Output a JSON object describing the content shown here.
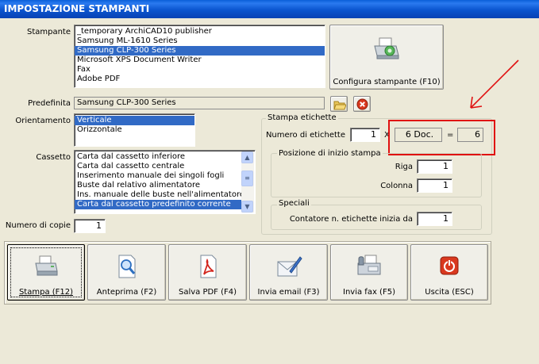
{
  "window": {
    "title": "IMPOSTAZIONE STAMPANTI"
  },
  "labels": {
    "stampante": "Stampante",
    "predefinita": "Predefinita",
    "orientamento": "Orientamento",
    "cassetto": "Cassetto",
    "numero_copie": "Numero di copie"
  },
  "printers": {
    "items": [
      "_temporary ArchiCAD10 publisher",
      "Samsung ML-1610 Series",
      "Samsung CLP-300 Series",
      "Microsoft XPS Document Writer",
      "Fax",
      "Adobe PDF"
    ],
    "selected": "Samsung CLP-300 Series"
  },
  "configure_button": {
    "label": "Configura stampante (F10)"
  },
  "default_printer": {
    "value": "Samsung CLP-300 Series"
  },
  "orientation": {
    "items": [
      "Verticale",
      "Orizzontale"
    ],
    "selected": "Verticale"
  },
  "trays": {
    "items": [
      "Carta dal cassetto inferiore",
      "Carta dal cassetto centrale",
      "Inserimento manuale dei singoli fogli",
      "Buste dal relativo alimentatore",
      "Ins. manuale delle buste nell'alimentatore",
      "Carta dal cassetto predefinito corrente"
    ],
    "selected": "Carta dal cassetto predefinito corrente"
  },
  "copies": {
    "value": "1"
  },
  "labels_group": {
    "title": "Stampa etichette",
    "count_label": "Numero di etichette",
    "count_value": "1",
    "times_sign": "X",
    "docs_value": "6 Doc.",
    "equals_sign": "=",
    "total_value": "6",
    "start_position": {
      "title": "Posizione di inizio stampa",
      "row_label": "Riga",
      "row_value": "1",
      "col_label": "Colonna",
      "col_value": "1"
    },
    "special": {
      "title": "Speciali",
      "counter_label": "Contatore n. etichette inizia da",
      "counter_value": "1"
    }
  },
  "actions": [
    {
      "label": "Stampa (F12)",
      "icon": "printer-icon"
    },
    {
      "label": "Anteprima (F2)",
      "icon": "preview-icon"
    },
    {
      "label": "Salva PDF (F4)",
      "icon": "pdf-icon"
    },
    {
      "label": "Invia email (F3)",
      "icon": "email-icon"
    },
    {
      "label": "Invia fax (F5)",
      "icon": "fax-icon"
    },
    {
      "label": "Uscita (ESC)",
      "icon": "exit-icon"
    }
  ],
  "colors": {
    "selection": "#316ac5",
    "annotation": "#e01010",
    "titlebar": "#0a5fd8",
    "exit_red": "#d9381e"
  }
}
